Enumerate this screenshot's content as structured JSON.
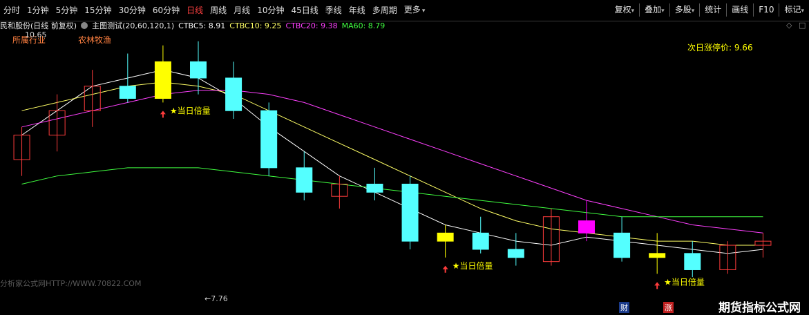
{
  "toolbar": {
    "periods": [
      {
        "label": "分时",
        "active": false,
        "dropdown": false
      },
      {
        "label": "1分钟",
        "active": false,
        "dropdown": false
      },
      {
        "label": "5分钟",
        "active": false,
        "dropdown": false
      },
      {
        "label": "15分钟",
        "active": false,
        "dropdown": false
      },
      {
        "label": "30分钟",
        "active": false,
        "dropdown": false
      },
      {
        "label": "60分钟",
        "active": false,
        "dropdown": false
      },
      {
        "label": "日线",
        "active": true,
        "dropdown": false
      },
      {
        "label": "周线",
        "active": false,
        "dropdown": false
      },
      {
        "label": "月线",
        "active": false,
        "dropdown": false
      },
      {
        "label": "10分钟",
        "active": false,
        "dropdown": false
      },
      {
        "label": "45日线",
        "active": false,
        "dropdown": false
      },
      {
        "label": "季线",
        "active": false,
        "dropdown": false
      },
      {
        "label": "年线",
        "active": false,
        "dropdown": false
      },
      {
        "label": "多周期",
        "active": false,
        "dropdown": false
      },
      {
        "label": "更多",
        "active": false,
        "dropdown": true
      }
    ],
    "right_buttons": [
      {
        "label": "复权",
        "dropdown": true
      },
      {
        "label": "叠加",
        "dropdown": true
      },
      {
        "label": "多股",
        "dropdown": true
      },
      {
        "label": "统计",
        "dropdown": false
      },
      {
        "label": "画线",
        "dropdown": false
      },
      {
        "label": "F10",
        "dropdown": false
      },
      {
        "label": "标记",
        "dropdown": true
      }
    ]
  },
  "infobar": {
    "stock_title": "民和股份(日线 前复权)",
    "indicator_name": "主图测试(20,60,120,1)",
    "ctbc5": "CTBC5: 8.91",
    "ctbc10": "CTBC10: 9.25",
    "ctbc20": "CTBC20: 9.38",
    "ma60": "MA60: 8.79"
  },
  "overlay": {
    "industry_label": "所属行业",
    "industry_value": "农林牧渔",
    "high_price": "10.65",
    "low_price": "←7.76",
    "limit_price_text": "次日涨停价: 9.66",
    "double_volume_label": "★当日倍量",
    "watermark": "分析家公式网HTTP://WWW.70822.COM",
    "marker_cai": "财",
    "marker_zhang": "涨",
    "brand": "期货指标公式网"
  },
  "colors": {
    "up": "#ff3c3c",
    "down": "#54ffff",
    "ctbc5": "#ffffff",
    "ctbc10": "#ffff66",
    "ctbc20": "#ff40ff",
    "ma60": "#40ff40",
    "double_volume": "#ffff00",
    "limit_bar": "#ff00ff",
    "active_period": "#ff4040"
  },
  "chart_data": {
    "type": "candlestick",
    "ylim": [
      7.6,
      10.75
    ],
    "candles": [
      {
        "o": 9.2,
        "h": 9.6,
        "l": 9.0,
        "c": 9.5
      },
      {
        "o": 9.5,
        "h": 10.0,
        "l": 9.3,
        "c": 9.8
      },
      {
        "o": 9.8,
        "h": 10.3,
        "l": 9.6,
        "c": 10.1
      },
      {
        "o": 10.1,
        "h": 10.5,
        "l": 9.9,
        "c": 9.95
      },
      {
        "o": 9.95,
        "h": 10.6,
        "l": 9.9,
        "c": 10.4
      },
      {
        "o": 10.4,
        "h": 10.65,
        "l": 10.0,
        "c": 10.2
      },
      {
        "o": 10.2,
        "h": 10.4,
        "l": 9.7,
        "c": 9.8
      },
      {
        "o": 9.8,
        "h": 9.9,
        "l": 9.0,
        "c": 9.1
      },
      {
        "o": 9.1,
        "h": 9.3,
        "l": 8.7,
        "c": 8.8
      },
      {
        "o": 8.75,
        "h": 9.0,
        "l": 8.6,
        "c": 8.9
      },
      {
        "o": 8.9,
        "h": 9.1,
        "l": 8.7,
        "c": 8.8
      },
      {
        "o": 8.9,
        "h": 9.0,
        "l": 8.1,
        "c": 8.2
      },
      {
        "o": 8.2,
        "h": 8.4,
        "l": 8.0,
        "c": 8.3
      },
      {
        "o": 8.3,
        "h": 8.5,
        "l": 8.05,
        "c": 8.1
      },
      {
        "o": 8.1,
        "h": 8.3,
        "l": 7.9,
        "c": 8.0
      },
      {
        "o": 7.95,
        "h": 8.6,
        "l": 7.9,
        "c": 8.5
      },
      {
        "o": 8.45,
        "h": 8.7,
        "l": 8.2,
        "c": 8.3
      },
      {
        "o": 8.3,
        "h": 8.5,
        "l": 7.95,
        "c": 8.0
      },
      {
        "o": 8.0,
        "h": 8.3,
        "l": 7.8,
        "c": 8.05
      },
      {
        "o": 8.05,
        "h": 8.2,
        "l": 7.76,
        "c": 7.85
      },
      {
        "o": 7.85,
        "h": 8.2,
        "l": 7.8,
        "c": 8.15
      },
      {
        "o": 8.15,
        "h": 8.3,
        "l": 8.0,
        "c": 8.2
      }
    ],
    "series": [
      {
        "name": "CTBC5",
        "values": [
          9.5,
          9.8,
          10.1,
          10.2,
          10.3,
          10.2,
          9.95,
          9.6,
          9.3,
          9.0,
          8.8,
          8.6,
          8.4,
          8.3,
          8.2,
          8.15,
          8.25,
          8.2,
          8.15,
          8.1,
          8.05,
          8.1
        ]
      },
      {
        "name": "CTBC10",
        "values": [
          9.8,
          9.9,
          10.0,
          10.1,
          10.15,
          10.1,
          10.0,
          9.8,
          9.6,
          9.4,
          9.2,
          9.0,
          8.8,
          8.6,
          8.45,
          8.35,
          8.3,
          8.25,
          8.2,
          8.2,
          8.15,
          8.15
        ]
      },
      {
        "name": "CTBC20",
        "values": [
          9.6,
          9.7,
          9.8,
          9.9,
          10.0,
          10.05,
          10.05,
          10.0,
          9.9,
          9.75,
          9.6,
          9.45,
          9.3,
          9.15,
          9.0,
          8.85,
          8.7,
          8.6,
          8.5,
          8.4,
          8.35,
          8.3
        ]
      },
      {
        "name": "MA60",
        "values": [
          8.9,
          9.0,
          9.05,
          9.1,
          9.1,
          9.1,
          9.05,
          9.0,
          8.95,
          8.9,
          8.85,
          8.8,
          8.75,
          8.7,
          8.65,
          8.6,
          8.55,
          8.5,
          8.5,
          8.5,
          8.5,
          8.5
        ]
      }
    ],
    "double_volume_candles": [
      {
        "index": 4,
        "label": "★当日倍量"
      },
      {
        "index": 12,
        "label": "★当日倍量"
      },
      {
        "index": 18,
        "label": "★当日倍量"
      }
    ],
    "limit_up_candle": {
      "index": 16
    },
    "xlabel": "",
    "ylabel": "",
    "grid": false
  }
}
